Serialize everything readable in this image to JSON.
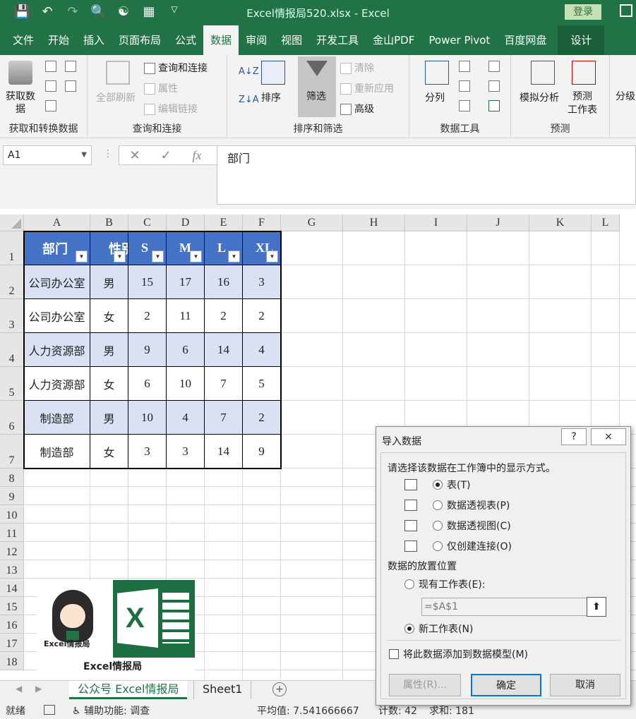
{
  "window": {
    "title": "Excel情报局520.xlsx  -  Excel",
    "login_label": "登录"
  },
  "ribbon_tabs": [
    "文件",
    "开始",
    "插入",
    "页面布局",
    "公式",
    "数据",
    "审阅",
    "视图",
    "开发工具",
    "金山PDF",
    "Power Pivot",
    "百度网盘"
  ],
  "ribbon_tab_design": "设计",
  "ribbon_tab_active": "数据",
  "ribbon": {
    "get_data": "获取数\n据",
    "get_data_group": "获取和转换数据",
    "refresh_all": "全部刷新",
    "query_conn": "查询和连接",
    "properties": "属性",
    "edit_links": "编辑链接",
    "query_group": "查询和连接",
    "sort": "排序",
    "filter": "筛选",
    "clear": "清除",
    "reapply": "重新应用",
    "advanced": "高级",
    "sort_group": "排序和筛选",
    "split": "分列",
    "data_tools_group": "数据工具",
    "whatif": "模拟分析",
    "forecast": "预测\n工作表",
    "forecast_group": "预测",
    "outline": "分级"
  },
  "formula_bar": {
    "name_box": "A1",
    "content": "部门",
    "fx": "fx"
  },
  "columns": [
    "A",
    "B",
    "C",
    "D",
    "E",
    "F",
    "G",
    "H",
    "I",
    "J",
    "K",
    "L"
  ],
  "rows": [
    "1",
    "2",
    "3",
    "4",
    "5",
    "6",
    "7",
    "8",
    "9",
    "10",
    "11",
    "12",
    "13",
    "14",
    "15",
    "16",
    "17",
    "18"
  ],
  "table": {
    "headers": [
      "部门",
      "性别",
      "S",
      "M",
      "L",
      "XL"
    ],
    "rows": [
      [
        "公司办公室",
        "男",
        "15",
        "17",
        "16",
        "3"
      ],
      [
        "公司办公室",
        "女",
        "2",
        "11",
        "2",
        "2"
      ],
      [
        "人力资源部",
        "男",
        "9",
        "6",
        "14",
        "4"
      ],
      [
        "人力资源部",
        "女",
        "6",
        "10",
        "7",
        "5"
      ],
      [
        "制造部",
        "男",
        "10",
        "4",
        "7",
        "2"
      ],
      [
        "制造部",
        "女",
        "3",
        "3",
        "14",
        "9"
      ]
    ],
    "header_color": "#4472c4",
    "band_color": "#d9e1f2"
  },
  "logo": {
    "caption": "Excel情报局",
    "avatar_caption": "Excel情报局"
  },
  "sheets": [
    "公众号 Excel情报局",
    "Sheet1"
  ],
  "active_sheet": "公众号 Excel情报局",
  "status": {
    "ready": "就绪",
    "accessibility": "辅助功能: 调查",
    "average": "平均值: 7.541666667",
    "count": "计数: 42",
    "sum": "求和: 181"
  },
  "dialog": {
    "title": "导入数据",
    "help": "?",
    "close": "×",
    "prompt": "请选择该数据在工作簿中的显示方式。",
    "options": [
      "表(T)",
      "数据透视表(P)",
      "数据透视图(C)",
      "仅创建连接(O)"
    ],
    "selected_option": "表(T)",
    "placement_label": "数据的放置位置",
    "existing_sheet": "现有工作表(E):",
    "range_value": "=$A$1",
    "new_sheet": "新工作表(N)",
    "selected_placement": "新工作表(N)",
    "add_model": "将此数据添加到数据模型(M)",
    "props_button": "属性(R)...",
    "ok": "确定",
    "cancel": "取消"
  }
}
